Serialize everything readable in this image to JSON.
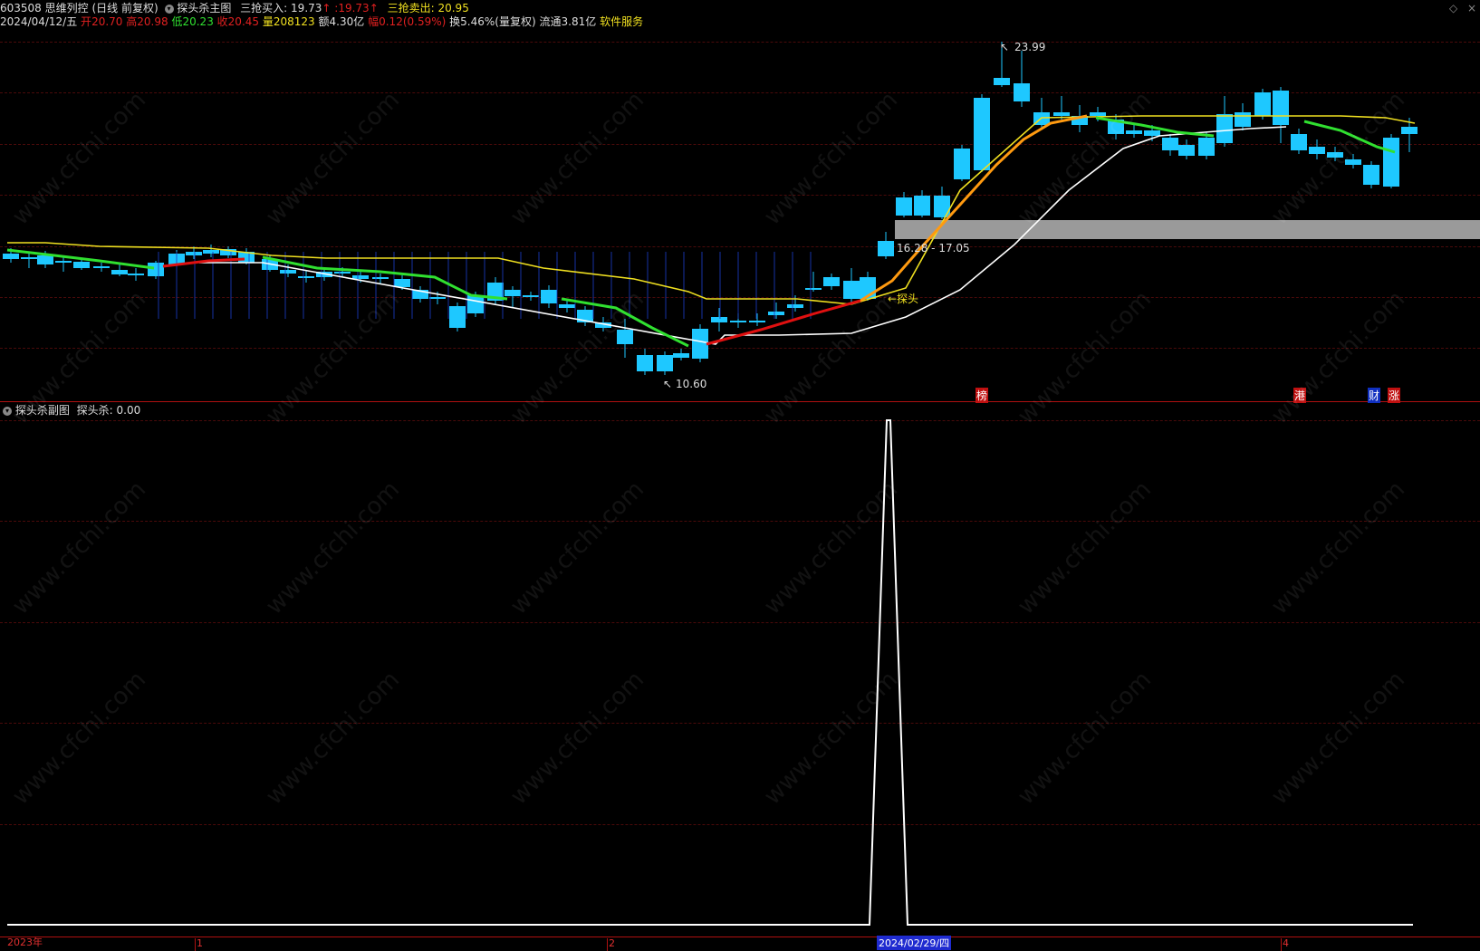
{
  "header": {
    "code": "603508",
    "name": "思维列控",
    "period": "(日线 前复权)",
    "indicator": "探头杀主图",
    "buy_label": "三抢买入:",
    "buy_value": "19.73",
    "buy_arrow": "↑",
    "buy_value2": ":19.73",
    "sell_label": "三抢卖出:",
    "sell_value": "20.95"
  },
  "quote": {
    "date": "2024/04/12/五",
    "open_label": "开",
    "open": "20.70",
    "high_label": "高",
    "high": "20.98",
    "low_label": "低",
    "low": "20.23",
    "close_label": "收",
    "close": "20.45",
    "vol_label": "量",
    "vol": "208123",
    "amt_label": "额",
    "amt": "4.30亿",
    "chg_label": "幅",
    "chg": "0.12(0.59%)",
    "turn_label": "换",
    "turn": "5.46%(量复权)",
    "float_label": "流通",
    "float": "3.81亿",
    "service": "软件服务"
  },
  "annotations": {
    "high_mark": "23.99",
    "low_mark": "10.60",
    "zone_label": "16.28 - 17.05",
    "probe_label": "←探头"
  },
  "tags": [
    {
      "text": "榜",
      "color": "#c01010"
    },
    {
      "text": "港",
      "color": "#c01010"
    },
    {
      "text": "财",
      "color": "#1030c0"
    },
    {
      "text": "涨",
      "color": "#c01010"
    }
  ],
  "sub": {
    "title": "探头杀副图",
    "value_label": "探头杀: 0.00"
  },
  "xaxis": {
    "labels": [
      "2023年",
      "1",
      "2",
      "2024/02/29/四",
      "4"
    ]
  },
  "colors": {
    "up": "#e02020",
    "down": "#1ec8ff",
    "ma_yellow": "#f0e020",
    "line_green": "#30e030",
    "line_red": "#e01010",
    "line_white": "#ffffff",
    "zone": "#9a9a9a"
  },
  "watermark": "www.cfchi.com"
}
